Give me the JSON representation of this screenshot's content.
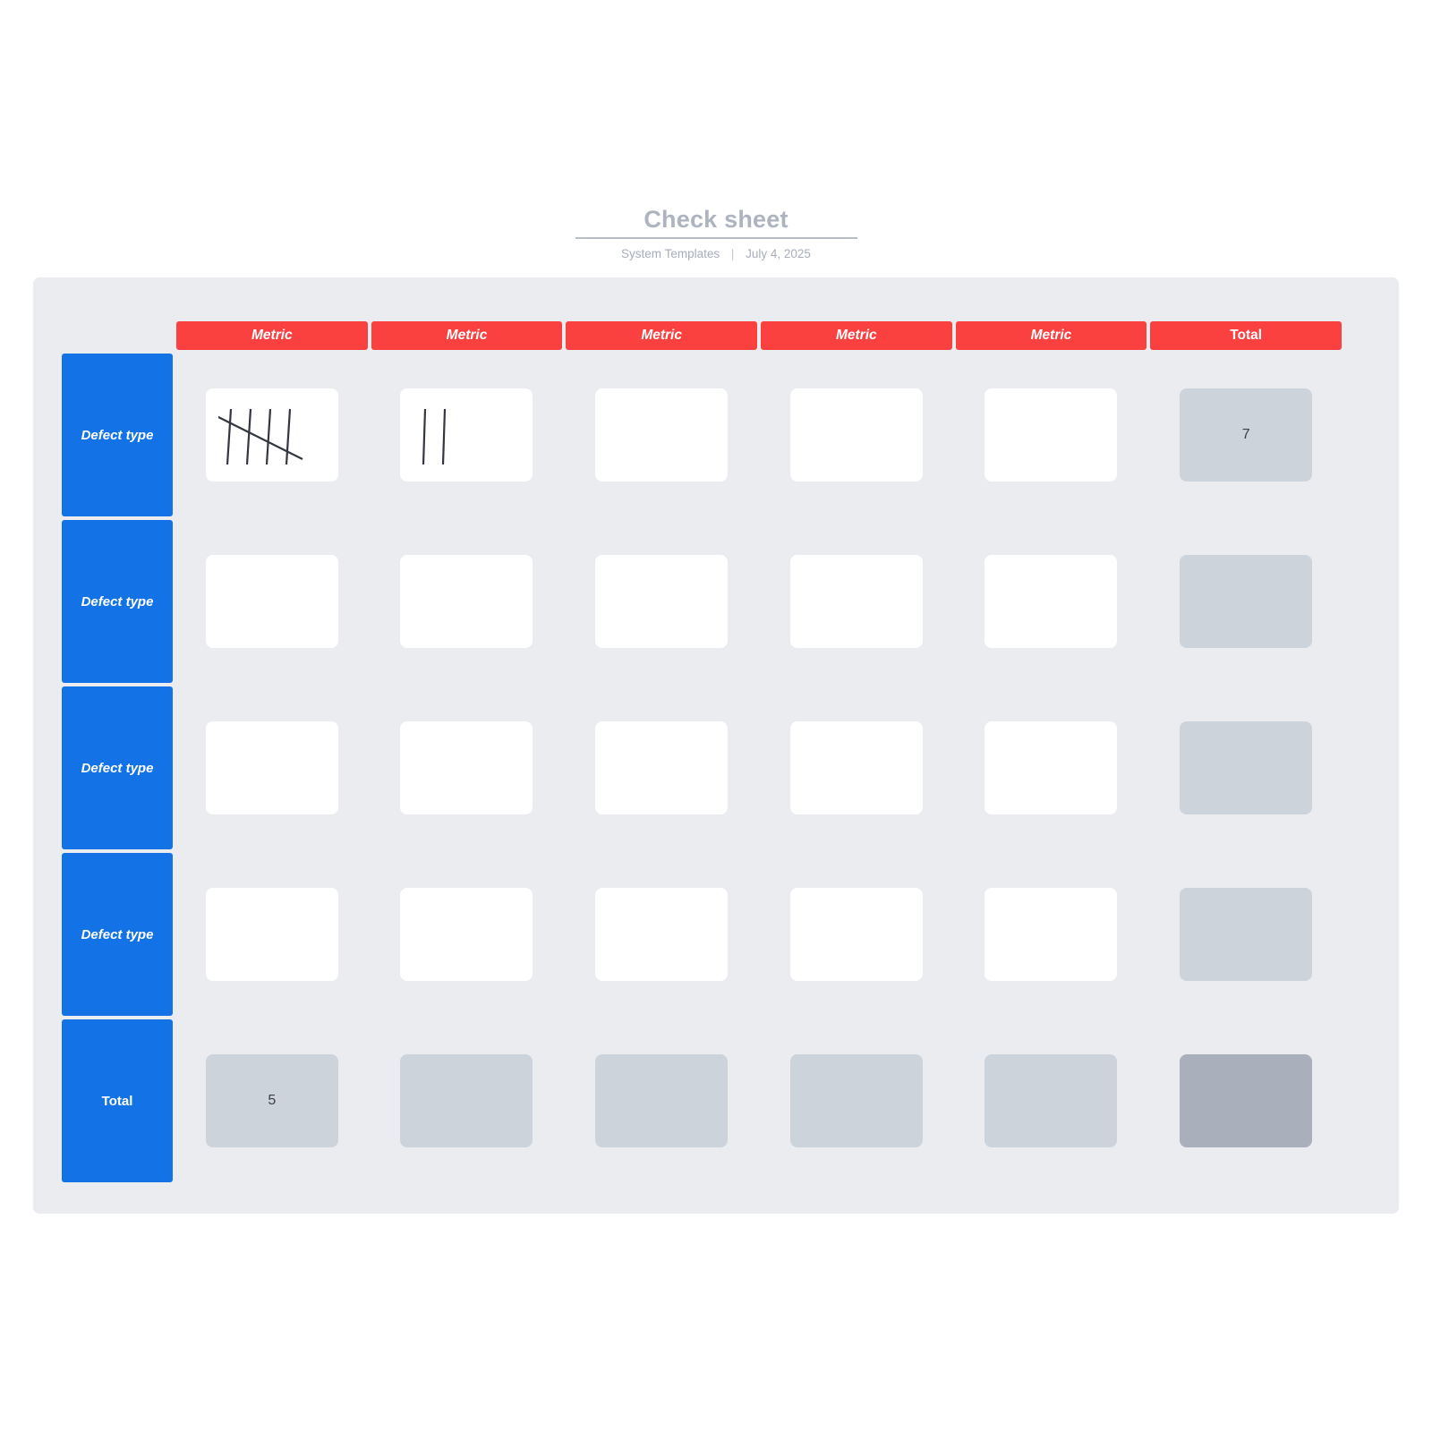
{
  "document": {
    "title": "Check sheet",
    "source": "System Templates",
    "separator": "|",
    "date": "July 4, 2025"
  },
  "theme": {
    "header_red": "#fb4040",
    "row_blue": "#1373e6",
    "canvas_grey": "#eaecf0",
    "total_grey": "#ccd3db",
    "grand_total_grey": "#a9b0bc",
    "title_grey": "#aeb3c0"
  },
  "table": {
    "corner_label": "",
    "columns": [
      {
        "label": "Metric",
        "kind": "metric"
      },
      {
        "label": "Metric",
        "kind": "metric"
      },
      {
        "label": "Metric",
        "kind": "metric"
      },
      {
        "label": "Metric",
        "kind": "metric"
      },
      {
        "label": "Metric",
        "kind": "metric"
      },
      {
        "label": "Total",
        "kind": "total"
      }
    ],
    "rows": [
      {
        "label": "Defect type",
        "kind": "defect",
        "cells": [
          {
            "kind": "tally",
            "tally": 5,
            "value": ""
          },
          {
            "kind": "tally",
            "tally": 2,
            "value": ""
          },
          {
            "kind": "blank",
            "value": ""
          },
          {
            "kind": "blank",
            "value": ""
          },
          {
            "kind": "blank",
            "value": ""
          },
          {
            "kind": "total",
            "value": "7"
          }
        ]
      },
      {
        "label": "Defect type",
        "kind": "defect",
        "cells": [
          {
            "kind": "blank",
            "value": ""
          },
          {
            "kind": "blank",
            "value": ""
          },
          {
            "kind": "blank",
            "value": ""
          },
          {
            "kind": "blank",
            "value": ""
          },
          {
            "kind": "blank",
            "value": ""
          },
          {
            "kind": "total",
            "value": ""
          }
        ]
      },
      {
        "label": "Defect type",
        "kind": "defect",
        "cells": [
          {
            "kind": "blank",
            "value": ""
          },
          {
            "kind": "blank",
            "value": ""
          },
          {
            "kind": "blank",
            "value": ""
          },
          {
            "kind": "blank",
            "value": ""
          },
          {
            "kind": "blank",
            "value": ""
          },
          {
            "kind": "total",
            "value": ""
          }
        ]
      },
      {
        "label": "Defect type",
        "kind": "defect",
        "cells": [
          {
            "kind": "blank",
            "value": ""
          },
          {
            "kind": "blank",
            "value": ""
          },
          {
            "kind": "blank",
            "value": ""
          },
          {
            "kind": "blank",
            "value": ""
          },
          {
            "kind": "blank",
            "value": ""
          },
          {
            "kind": "total",
            "value": ""
          }
        ]
      },
      {
        "label": "Total",
        "kind": "total",
        "cells": [
          {
            "kind": "total",
            "value": "5"
          },
          {
            "kind": "total",
            "value": ""
          },
          {
            "kind": "total",
            "value": ""
          },
          {
            "kind": "total",
            "value": ""
          },
          {
            "kind": "total",
            "value": ""
          },
          {
            "kind": "grand",
            "value": ""
          }
        ]
      }
    ]
  }
}
